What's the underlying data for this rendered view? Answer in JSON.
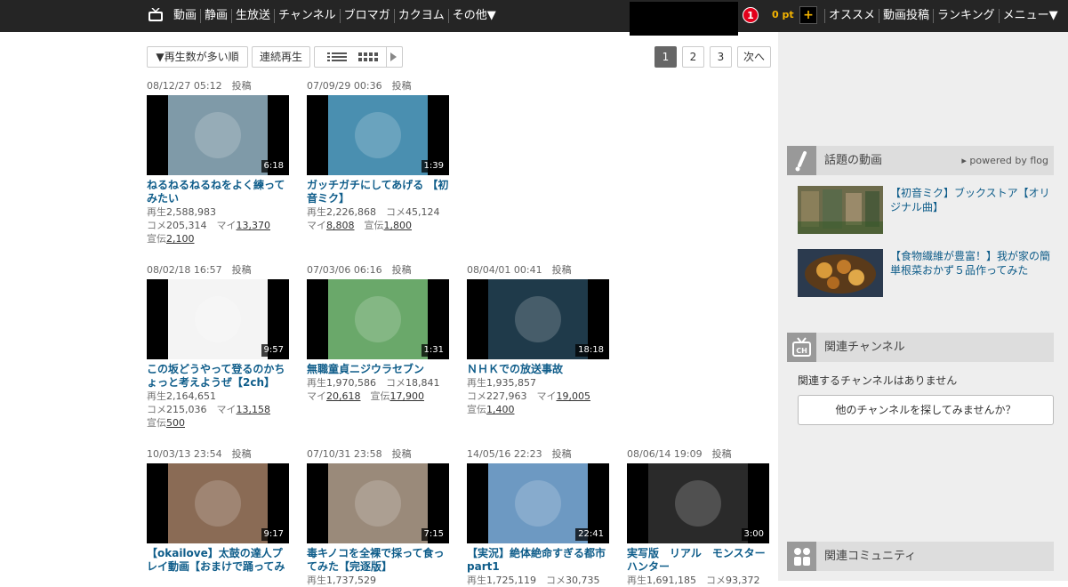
{
  "header": {
    "nav_left": [
      "動画",
      "静画",
      "生放送",
      "チャンネル",
      "ブロマガ",
      "カクヨム",
      "その他▼"
    ],
    "notification_count": "1",
    "points": "0 pt",
    "plus": "+",
    "nav_right": [
      "オススメ",
      "動画投稿",
      "ランキング",
      "メニュー▼"
    ]
  },
  "toolbar": {
    "sort_label": "▼再生数が多い順",
    "continuous_label": "連続再生"
  },
  "pager": {
    "pages": [
      "1",
      "2",
      "3"
    ],
    "active": "1",
    "next": "次へ"
  },
  "labels": {
    "posted": "投稿",
    "plays": "再生",
    "comments": "コメ",
    "mylists": "マイ",
    "ads": "宣伝"
  },
  "videos": [
    {
      "date": "08/12/27 05:12",
      "duration": "6:18",
      "title": "ねるねるねるねをよく練ってみたい",
      "plays": "2,588,983",
      "comments": "205,314",
      "mylists": "13,370",
      "ads": "2,100",
      "thumb": "#7f9aa8"
    },
    {
      "date": "07/09/29 00:36",
      "duration": "1:39",
      "title": "ガッチガチにしてあげる 【初音ミク】",
      "plays": "2,226,868",
      "comments": "45,124",
      "mylists": "8,808",
      "ads": "1,800",
      "thumb": "#4a8fb0"
    },
    {
      "date": "08/02/18 16:57",
      "duration": "9:57",
      "title": "この坂どうやって登るのかちょっと考えようぜ【2ch】",
      "plays": "2,164,651",
      "comments": "215,036",
      "mylists": "13,158",
      "ads": "500",
      "thumb": "#f4f4f4"
    },
    {
      "date": "07/03/06 06:16",
      "duration": "1:31",
      "title": "無職童貞ニジウラセブン",
      "plays": "1,970,586",
      "comments": "18,841",
      "mylists": "20,618",
      "ads": "17,900",
      "thumb": "#6aa86a"
    },
    {
      "date": "08/04/01 00:41",
      "duration": "18:18",
      "title": "ＮＨＫでの放送事故",
      "plays": "1,935,857",
      "comments": "227,963",
      "mylists": "19,005",
      "ads": "1,400",
      "thumb": "#1f3a4a"
    },
    {
      "date": "10/03/13 23:54",
      "duration": "9:17",
      "title": "【okailove】太鼓の達人プレイ動画【おまけで踊ってみた】",
      "plays": "",
      "comments": "",
      "mylists": "",
      "ads": "",
      "thumb": "#8a6b55"
    },
    {
      "date": "07/10/31 23:58",
      "duration": "7:15",
      "title": "毒キノコを全裸で採って食ってみた【完逐版】",
      "plays": "1,737,529",
      "comments": "",
      "mylists": "",
      "ads": "",
      "thumb": "#9a8a7a"
    },
    {
      "date": "14/05/16 22:23",
      "duration": "22:41",
      "title": "【実況】絶体絶命すぎる都市part1",
      "plays": "1,725,119",
      "comments": "30,735",
      "mylists": "",
      "ads": "",
      "thumb": "#6d99c2"
    },
    {
      "date": "08/06/14 19:09",
      "duration": "3:00",
      "title": "実写版　リアル　モンスターハンター",
      "plays": "1,691,185",
      "comments": "93,372",
      "mylists": "",
      "ads": "",
      "thumb": "#2a2a2a"
    }
  ],
  "sidebar": {
    "hot_title": "話題の動画",
    "powered_by": "▸ powered by flog",
    "hot_items": [
      {
        "title": "【初音ミク】ブックストア【オリジナル曲】",
        "thumb": "#7a7a55"
      },
      {
        "title": "【食物繊維が豊富！】我が家の簡単根菜おかず５品作ってみた",
        "thumb": "#7a4a2a"
      }
    ],
    "channel_title": "関連チャンネル",
    "no_channel": "関連するチャンネルはありません",
    "find_channel": "他のチャンネルを探してみませんか？",
    "community_title": "関連コミュニティ"
  }
}
